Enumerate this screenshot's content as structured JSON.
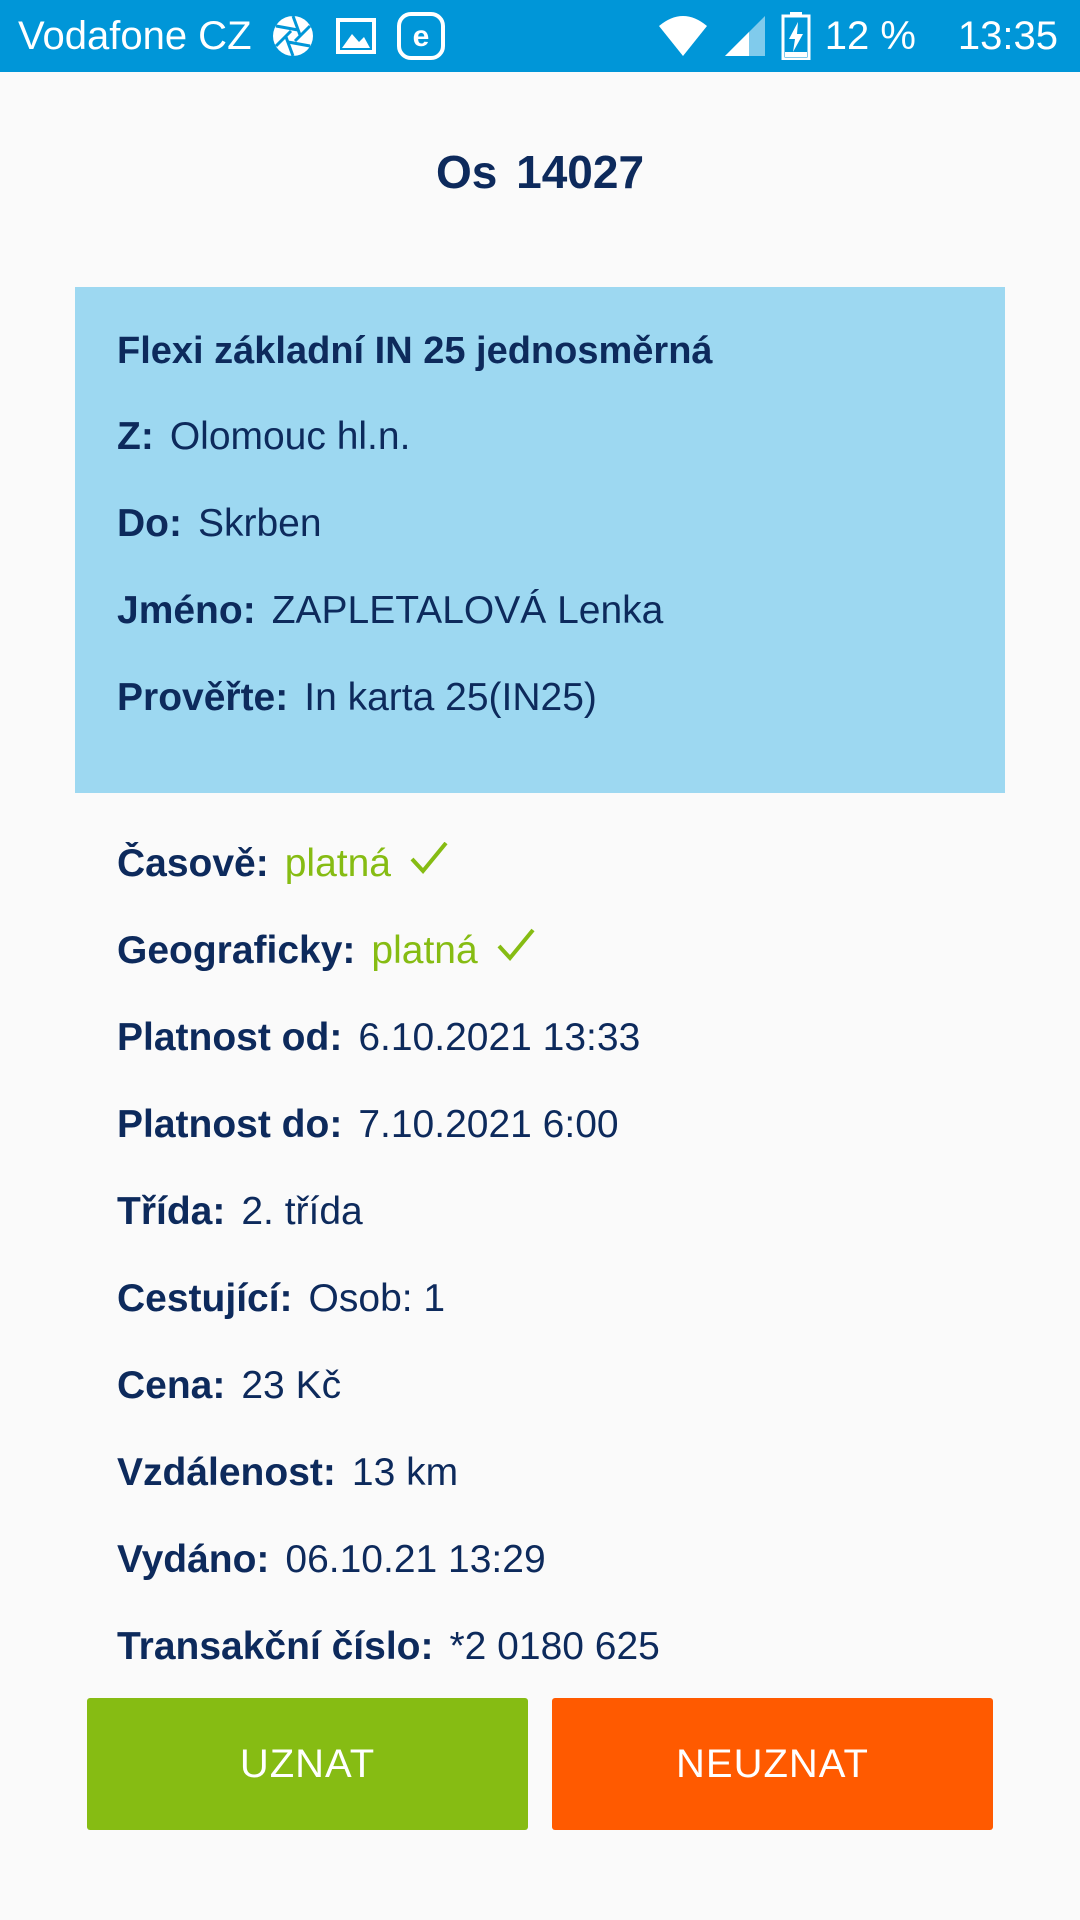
{
  "status_bar": {
    "carrier": "Vodafone CZ",
    "battery": "12 %",
    "time": "13:35",
    "icons": [
      "aperture-icon",
      "image-icon",
      "e-app-icon",
      "wifi-icon",
      "signal-icon",
      "battery-charging-icon"
    ]
  },
  "train_title": "Os 14027",
  "ticket": {
    "name": "Flexi základní IN 25 jednosměrná",
    "from": {
      "label": "Z:",
      "value": "Olomouc hl.n."
    },
    "to": {
      "label": "Do:",
      "value": "Skrben"
    },
    "name_field": {
      "label": "Jméno:",
      "value": "ZAPLETALOVÁ Lenka"
    },
    "check": {
      "label": "Prověřte:",
      "value": "In karta 25(IN25)"
    }
  },
  "details": {
    "time_validity": {
      "label": "Časově:",
      "value": "platná"
    },
    "geo_validity": {
      "label": "Geograficky:",
      "value": "platná"
    },
    "valid_from": {
      "label": "Platnost od:",
      "value": "6.10.2021 13:33"
    },
    "valid_to": {
      "label": "Platnost do:",
      "value": "7.10.2021 6:00"
    },
    "class": {
      "label": "Třída:",
      "value": "2. třída"
    },
    "passengers": {
      "label": "Cestující:",
      "value": "Osob: 1"
    },
    "price": {
      "label": "Cena:",
      "value": "23 Kč"
    },
    "distance": {
      "label": "Vzdálenost:",
      "value": "13 km"
    },
    "issued": {
      "label": "Vydáno:",
      "value": "06.10.21 13:29"
    },
    "transaction": {
      "label": "Transakční číslo:",
      "value": "*2 0180 625"
    }
  },
  "buttons": {
    "accept": "UZNAT",
    "reject": "NEUZNAT"
  },
  "colors": {
    "status_bar": "#0096d8",
    "ticket_box": "#9dd8f1",
    "text": "#0d2a5c",
    "valid": "#86bc13",
    "accept": "#86bc13",
    "reject": "#ff5a00"
  }
}
